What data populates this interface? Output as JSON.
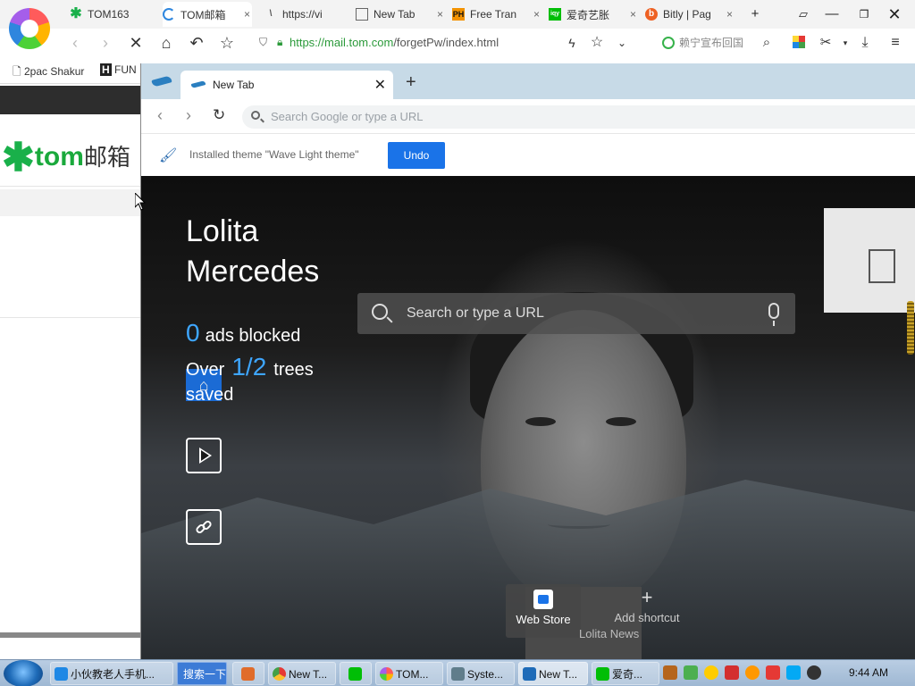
{
  "outer_browser": {
    "tabs": [
      {
        "label": "TOM163",
        "icon": "tom-star-icon",
        "icon_color": "#19b04a"
      },
      {
        "label": "TOM邮箱",
        "icon": "loading-spinner-icon",
        "active": true
      },
      {
        "label": "https://vi",
        "icon": "v-icon"
      },
      {
        "label": "New Tab",
        "icon": "page-icon"
      },
      {
        "label": "Free Tran",
        "icon": "ph-icon",
        "icon_color": "#f39200"
      },
      {
        "label": "爱奇艺胀",
        "icon": "iqiyi-icon",
        "icon_color": "#00be06"
      },
      {
        "label": "Bitly | Pag",
        "icon": "bitly-icon",
        "icon_color": "#ee6123"
      }
    ],
    "address": {
      "host": "https://mail.tom.com",
      "path": "/forgetPw/index.html"
    },
    "search_placeholder": "赖宁宣布回国",
    "bookmarks": [
      {
        "label": "2pac Shakur",
        "icon": "page-icon"
      },
      {
        "label": "FUN",
        "icon": "h-icon"
      }
    ],
    "page": {
      "logo_text": "tom",
      "logo_cn": "邮箱"
    }
  },
  "inner_browser": {
    "tab_title": "New Tab",
    "omnibox_placeholder": "Search Google or type a URL",
    "infobar": {
      "message": "Installed theme \"Wave Light theme\"",
      "undo_label": "Undo"
    },
    "greeting": {
      "line1": "Lolita",
      "line2": "Mercedes"
    },
    "stats": {
      "ads_count": "0",
      "ads_label": "ads blocked",
      "trees_prefix": "Over",
      "trees_count": "1/2",
      "trees_suffix": "trees saved"
    },
    "search_placeholder": "Search or type a URL",
    "shortcuts": [
      {
        "label": "Web Store",
        "icon": "web-store-icon"
      },
      {
        "label": "Add shortcut",
        "icon": "plus-icon"
      }
    ],
    "news_label": "Lolita News"
  },
  "taskbar": {
    "items": [
      {
        "label": "小伙教老人手机...",
        "icon": "ie-icon",
        "color": "#1e88e5"
      },
      {
        "label": "搜索一下",
        "search": true
      },
      {
        "label": "",
        "icon": "app-icon",
        "color": "#e06c2b"
      },
      {
        "label": "New T...",
        "icon": "chrome-icon",
        "color": "#e53935"
      },
      {
        "label": "",
        "icon": "iqiyi-icon",
        "color": "#00be06"
      },
      {
        "label": "TOM...",
        "icon": "browser-icon",
        "color": "#a55eea"
      },
      {
        "label": "Syste...",
        "icon": "system-icon",
        "color": "#607d8b"
      },
      {
        "label": "New T...",
        "icon": "shield-browser-icon",
        "color": "#1e6bb8"
      },
      {
        "label": "爱奇...",
        "icon": "iqiyi-icon",
        "color": "#00be06"
      }
    ],
    "tray_colors": [
      "#b5651d",
      "#4caf50",
      "#ffcc00",
      "#d32f2f",
      "#ff9800",
      "#e53935",
      "#03a9f4",
      "#333333"
    ],
    "clock": "9:44 AM"
  }
}
